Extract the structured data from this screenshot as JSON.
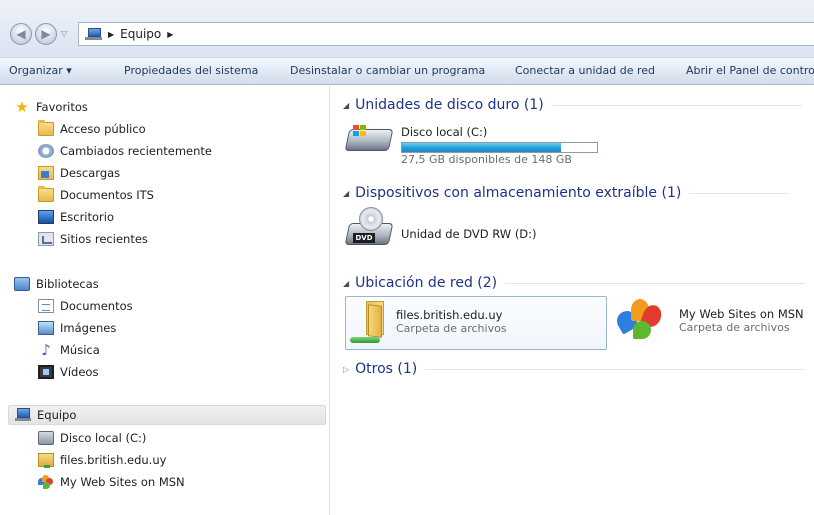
{
  "address_bar": {
    "back_icon": "back-arrow-icon",
    "forward_icon": "forward-arrow-icon",
    "crumbs": [
      "Equipo"
    ]
  },
  "command_bar": {
    "items": [
      "Organizar ▾",
      "Propiedades del sistema",
      "Desinstalar o cambiar un programa",
      "Conectar a unidad de red",
      "Abrir el Panel de control"
    ]
  },
  "nav": {
    "favorites": {
      "label": "Favoritos",
      "items": [
        "Acceso público",
        "Cambiados recientemente",
        "Descargas",
        "Documentos ITS",
        "Escritorio",
        "Sitios recientes"
      ]
    },
    "libraries": {
      "label": "Bibliotecas",
      "items": [
        "Documentos",
        "Imágenes",
        "Música",
        "Vídeos"
      ]
    },
    "computer": {
      "label": "Equipo",
      "items": [
        "Disco local (C:)",
        "files.british.edu.uy",
        "My Web Sites on MSN"
      ]
    }
  },
  "content": {
    "hard_drives": {
      "header": "Unidades de disco duro (1)",
      "drive_name": "Disco local (C:)",
      "free_text": "27,5 GB disponibles de 148 GB",
      "used_fraction": 0.814
    },
    "removable": {
      "header": "Dispositivos con almacenamiento extraíble (1)",
      "dvd_name": "Unidad de DVD RW (D:)",
      "dvd_badge": "DVD"
    },
    "network": {
      "header": "Ubicación de red (2)",
      "items": [
        {
          "name": "files.british.edu.uy",
          "type": "Carpeta de archivos"
        },
        {
          "name": "My Web Sites on MSN",
          "type": "Carpeta de archivos"
        }
      ]
    },
    "others": {
      "header": "Otros (1)"
    }
  },
  "colors": {
    "group_header": "#1e3287",
    "progress_fill": "#26a0da",
    "selection_border": "#99b6d4"
  }
}
